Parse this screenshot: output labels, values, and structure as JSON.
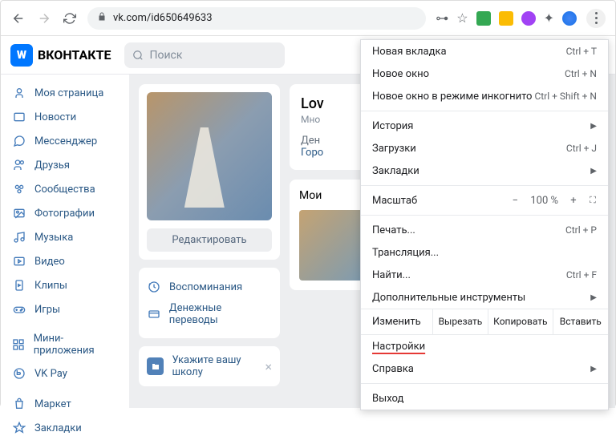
{
  "browser": {
    "url": "vk.com/id650649633",
    "ext_colors": [
      "#34a853",
      "#fbbc04",
      "#a142f4",
      "#202124",
      "#4285f4"
    ]
  },
  "vk": {
    "brand": "ВКОНТАКТЕ",
    "search_placeholder": "Поиск",
    "sidebar": [
      "Моя страница",
      "Новости",
      "Мессенджер",
      "Друзья",
      "Сообщества",
      "Фотографии",
      "Музыка",
      "Видео",
      "Клипы",
      "Игры",
      "Мини-приложения",
      "VK Pay",
      "Маркет",
      "Закладки"
    ],
    "edit_btn": "Редактировать",
    "memories": "Воспоминания",
    "transfers": "Денежные переводы",
    "school": "Укажите вашу школу",
    "profile_name": "Lov",
    "profile_sub": "Мно",
    "birthday_lbl": "Ден",
    "city_lbl": "Горо",
    "photos_title": "Мои"
  },
  "menu": {
    "new_tab": "Новая вкладка",
    "new_tab_sc": "Ctrl + T",
    "new_window": "Новое окно",
    "new_window_sc": "Ctrl + N",
    "incognito": "Новое окно в режиме инкогнито",
    "incognito_sc": "Ctrl + Shift + N",
    "history": "История",
    "downloads": "Загрузки",
    "downloads_sc": "Ctrl + J",
    "bookmarks": "Закладки",
    "zoom": "Масштаб",
    "zoom_val": "100 %",
    "print": "Печать...",
    "print_sc": "Ctrl + P",
    "cast": "Трансляция...",
    "find": "Найти...",
    "find_sc": "Ctrl + F",
    "tools": "Дополнительные инструменты",
    "edit": "Изменить",
    "cut": "Вырезать",
    "copy": "Копировать",
    "paste": "Вставить",
    "settings": "Настройки",
    "help": "Справка",
    "exit": "Выход"
  }
}
